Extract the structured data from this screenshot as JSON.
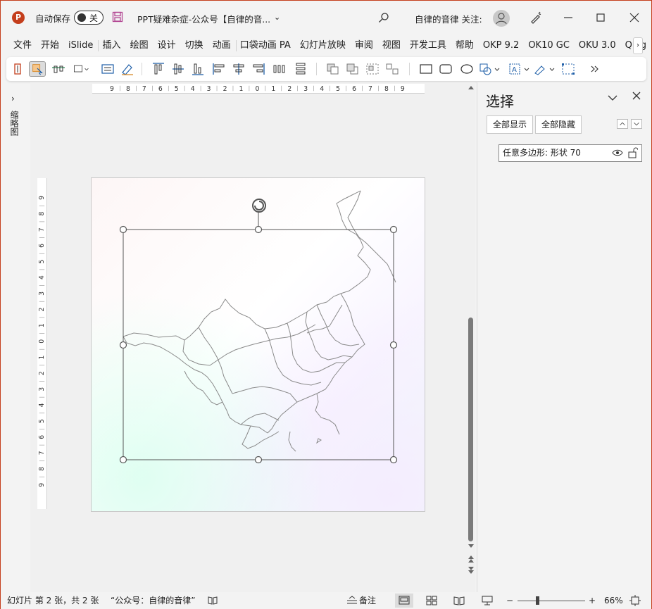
{
  "titlebar": {
    "app_logo": "P",
    "autosave_label": "自动保存",
    "autosave_state": "关",
    "doc_title": "PPT疑难杂症-公众号【自律的音...",
    "user": "自律的音律 关注:"
  },
  "tabs": [
    "文件",
    "开始",
    "iSlide",
    "插入",
    "绘图",
    "设计",
    "切换",
    "动画",
    "口袋动画 PA",
    "幻灯片放映",
    "审阅",
    "视图",
    "开发工具",
    "帮助",
    "OKP 9.2",
    "OK10 GC",
    "OKU 3.0",
    "Qing"
  ],
  "left_pane": {
    "label": "缩略图"
  },
  "ruler": {
    "horizontal": [
      "9",
      "8",
      "7",
      "6",
      "5",
      "4",
      "3",
      "2",
      "1",
      "0",
      "1",
      "2",
      "3",
      "4",
      "5",
      "6",
      "7",
      "8",
      "9"
    ],
    "vertical": [
      "9",
      "8",
      "7",
      "6",
      "5",
      "4",
      "3",
      "2",
      "1",
      "0",
      "1",
      "2",
      "3",
      "4",
      "5",
      "6",
      "7",
      "8",
      "9"
    ]
  },
  "selection_pane": {
    "title": "选择",
    "show_all": "全部显示",
    "hide_all": "全部隐藏",
    "items": [
      {
        "label": "任意多边形: 形状 70"
      }
    ]
  },
  "statusbar": {
    "slide_info": "幻灯片 第 2 张，共 2 张",
    "note": "“公众号：自律的音律”",
    "notes_btn": "备注",
    "zoom": "66%"
  },
  "colors": {
    "accent": "#c43e1c",
    "selection": "#555555"
  }
}
